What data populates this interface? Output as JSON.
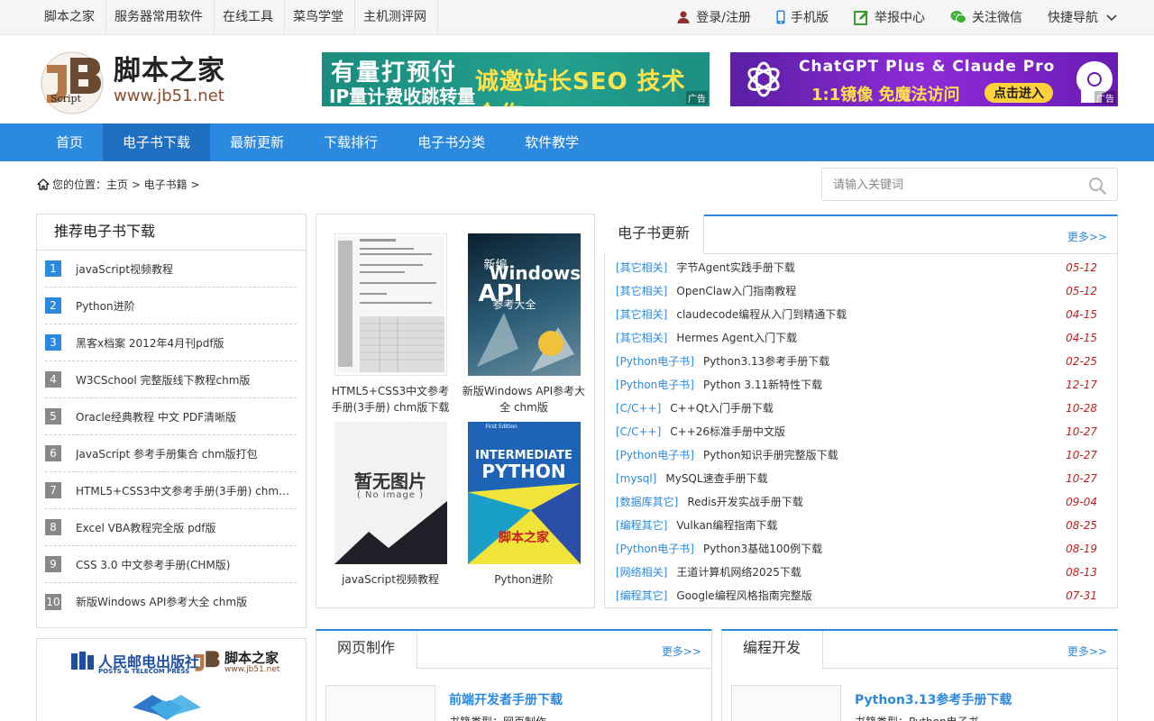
{
  "topbar": {
    "nav": [
      "脚本之家",
      "服务器常用软件",
      "在线工具",
      "菜鸟学堂",
      "主机测评网"
    ],
    "right": {
      "login": "登录/注册",
      "mobile": "手机版",
      "report": "举报中心",
      "wechat": "关注微信",
      "quicknav": "快捷导航"
    }
  },
  "logo": {
    "name": "脚本之家",
    "url": "www.jb51.net",
    "badge": "Script"
  },
  "ads": {
    "ad1": {
      "line1": "有量打预付",
      "line2": "IP量计费收跳转量",
      "line3": "诚邀站长SEO 技术合作",
      "tag": "广告"
    },
    "ad2": {
      "line1": "ChatGPT Plus & Claude Pro",
      "line2": "1:1镜像  免魔法访问",
      "cta": "点击进入",
      "tag": "广告"
    }
  },
  "mainnav": [
    "首页",
    "电子书下载",
    "最新更新",
    "下载排行",
    "电子书分类",
    "软件教学"
  ],
  "breadcrumb": {
    "text": "您的位置：主页 > 电子书籍 >"
  },
  "search": {
    "placeholder": "请输入关键词"
  },
  "recommend": {
    "title": "推荐电子书下载",
    "items": [
      {
        "n": "1",
        "title": "javaScript视频教程"
      },
      {
        "n": "2",
        "title": "Python进阶"
      },
      {
        "n": "3",
        "title": "黑客x档案 2012年4月刊pdf版"
      },
      {
        "n": "4",
        "title": "W3CSchool 完整版线下教程chm版"
      },
      {
        "n": "5",
        "title": "Oracle经典教程 中文 PDF清晰版"
      },
      {
        "n": "6",
        "title": "JavaScript 参考手册集合 chm版打包"
      },
      {
        "n": "7",
        "title": "HTML5+CSS3中文参考手册(3手册) chm版下载"
      },
      {
        "n": "8",
        "title": "Excel VBA教程完全版 pdf版"
      },
      {
        "n": "9",
        "title": "CSS 3.0 中文参考手册(CHM版)"
      },
      {
        "n": "10",
        "title": "新版Windows API参考大全 chm版"
      }
    ]
  },
  "leftad": {
    "pub": "人民邮电出版社",
    "pub_en": "POSTS & TELECOM PRESS",
    "brand": "脚本之家",
    "url": "www.jb51.net"
  },
  "covers": [
    {
      "caption": "HTML5+CSS3中文参考手册(3手册) chm版下载"
    },
    {
      "caption": "新版Windows API参考大全 chm版",
      "cover_a": "新编",
      "cover_b": "Windows",
      "cover_c": "API",
      "cover_d": "参考大全"
    },
    {
      "caption": "javaScript视频教程",
      "noimg_cn": "暂无图片",
      "noimg_en": "( No image )"
    },
    {
      "caption": "Python进阶",
      "cover_a": "First Edition",
      "cover_b": "INTERMEDIATE",
      "cover_c": "PYTHON",
      "cover_d": "脚本之家"
    }
  ],
  "updates": {
    "title": "电子书更新",
    "more": "更多>>",
    "items": [
      {
        "cat": "[其它相关]",
        "title": "字节Agent实践手册下载",
        "date": "05-12"
      },
      {
        "cat": "[其它相关]",
        "title": "OpenClaw入门指南教程",
        "date": "05-12"
      },
      {
        "cat": "[其它相关]",
        "title": "claudecode编程从入门到精通下载",
        "date": "04-15"
      },
      {
        "cat": "[其它相关]",
        "title": "Hermes Agent入门下载",
        "date": "04-15"
      },
      {
        "cat": "[Python电子书]",
        "title": "Python3.13参考手册下载",
        "date": "02-25"
      },
      {
        "cat": "[Python电子书]",
        "title": "Python 3.11新特性下载",
        "date": "12-17"
      },
      {
        "cat": "[C/C++]",
        "title": "C++Qt入门手册下载",
        "date": "10-28"
      },
      {
        "cat": "[C/C++]",
        "title": "C++26标准手册中文版",
        "date": "10-27"
      },
      {
        "cat": "[Python电子书]",
        "title": "Python知识手册完整版下载",
        "date": "10-27"
      },
      {
        "cat": "[mysql]",
        "title": "MySQL速查手册下载",
        "date": "10-27"
      },
      {
        "cat": "[数据库其它]",
        "title": "Redis开发实战手册下载",
        "date": "09-04"
      },
      {
        "cat": "[编程其它]",
        "title": "Vulkan编程指南下载",
        "date": "08-25"
      },
      {
        "cat": "[Python电子书]",
        "title": "Python3基础100例下载",
        "date": "08-19"
      },
      {
        "cat": "[网络相关]",
        "title": "王道计算机网络2025下载",
        "date": "08-13"
      },
      {
        "cat": "[编程其它]",
        "title": "Google编程风格指南完整版",
        "date": "07-31"
      }
    ]
  },
  "web": {
    "title": "网页制作",
    "more": "更多>>",
    "book_title": "前端开发者手册下载",
    "book_meta": "书籍类型：网页制作"
  },
  "dev": {
    "title": "编程开发",
    "more": "更多>>",
    "book_title": "Python3.13参考手册下载",
    "book_meta": "书籍类型：Python电子书"
  },
  "colors": {
    "accent": "#2b8ae0",
    "nav_active": "#1e6fc2",
    "date": "#c01f1f",
    "logo_brown": "#8a4b2c"
  }
}
